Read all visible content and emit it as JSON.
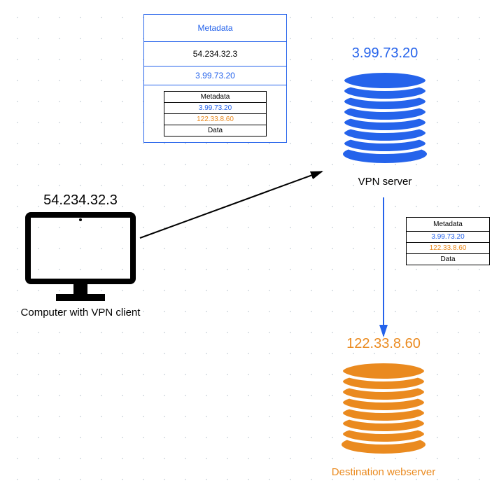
{
  "client": {
    "ip": "54.234.32.3",
    "label": "Computer with VPN client"
  },
  "vpn": {
    "ip": "3.99.73.20",
    "label": "VPN server",
    "color": "#2563eb"
  },
  "dest": {
    "ip": "122.33.8.60",
    "label": "Destination webserver",
    "color": "#ea8a1f"
  },
  "outer_packet": {
    "metadata_label": "Metadata",
    "src_ip": "54.234.32.3",
    "dst_ip": "3.99.73.20",
    "inner": {
      "metadata_label": "Metadata",
      "src_ip": "3.99.73.20",
      "dst_ip": "122.33.8.60",
      "data_label": "Data"
    }
  },
  "inner_packet_copy": {
    "metadata_label": "Metadata",
    "src_ip": "3.99.73.20",
    "dst_ip": "122.33.8.60",
    "data_label": "Data"
  },
  "chart_data": {
    "type": "network-diagram",
    "nodes": [
      {
        "id": "client",
        "label": "Computer with VPN client",
        "ip": "54.234.32.3"
      },
      {
        "id": "vpn",
        "label": "VPN server",
        "ip": "3.99.73.20"
      },
      {
        "id": "dest",
        "label": "Destination webserver",
        "ip": "122.33.8.60"
      }
    ],
    "edges": [
      {
        "from": "client",
        "to": "vpn",
        "packet_layers": [
          "Metadata",
          "54.234.32.3",
          "3.99.73.20",
          {
            "inner": [
              "Metadata",
              "3.99.73.20",
              "122.33.8.60",
              "Data"
            ]
          }
        ]
      },
      {
        "from": "vpn",
        "to": "dest",
        "packet_layers": [
          "Metadata",
          "3.99.73.20",
          "122.33.8.60",
          "Data"
        ]
      }
    ]
  }
}
